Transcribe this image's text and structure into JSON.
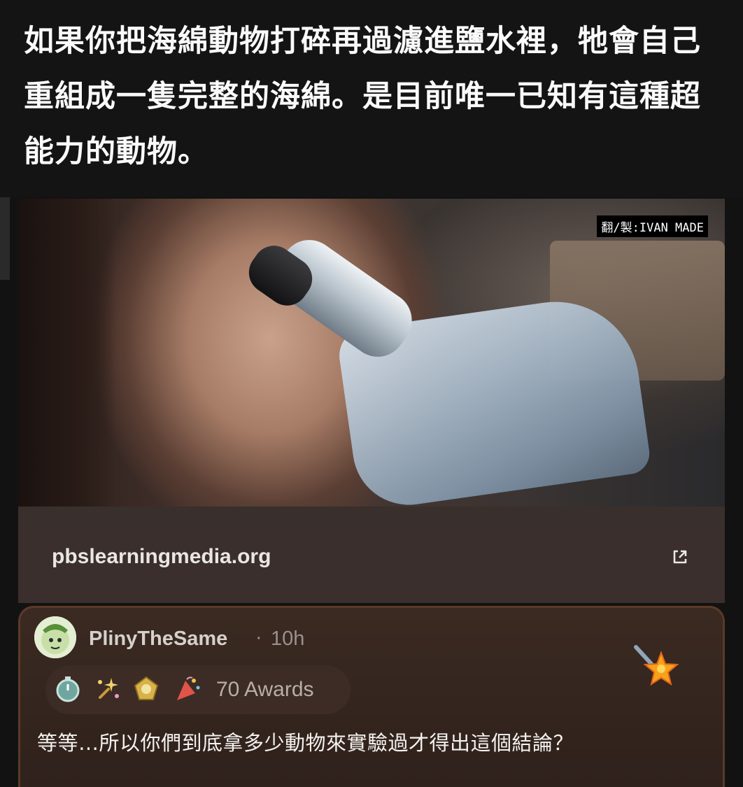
{
  "caption": {
    "text": "如果你把海綿動物打碎再過濾進鹽水裡，牠會自己重組成一隻完整的海綿。是目前唯一已知有這種超能力的動物。"
  },
  "preview": {
    "watermark": "翻/製:IVAN MADE",
    "link_text": "pbslearningmedia.org",
    "external_icon": "external-link-icon"
  },
  "comment": {
    "username": "PlinyTheSame",
    "separator": "·",
    "timestamp": "10h",
    "awards_count": "70 Awards",
    "body": "等等…所以你們到底拿多少動物來實驗過才得出這個結論？",
    "award_icons": [
      "timer-award-icon",
      "sparkle-award-icon",
      "medal-award-icon",
      "party-award-icon"
    ],
    "accent_border": "#5b3a28"
  }
}
